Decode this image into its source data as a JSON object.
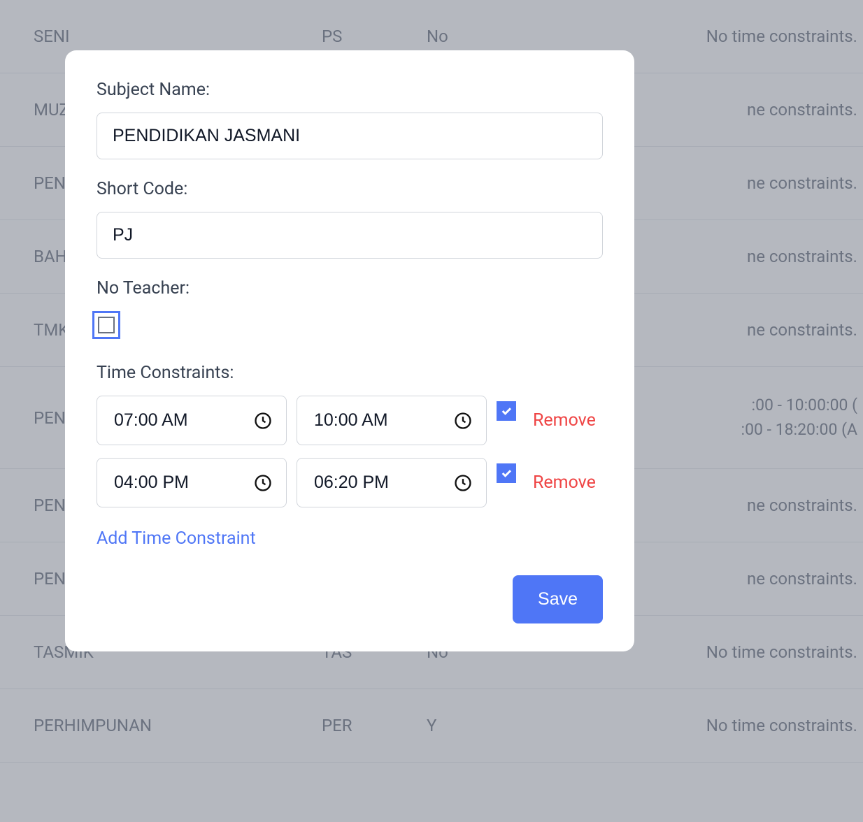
{
  "background": {
    "rows": [
      {
        "name": "SENI",
        "code": "PS",
        "teacher": "No",
        "constraints": "No time constraints."
      },
      {
        "name": "MUZIK",
        "code": "",
        "teacher": "",
        "constraints": "ne constraints."
      },
      {
        "name": "PENDIDIKAN ISLAM",
        "code": "",
        "teacher": "",
        "constraints": "ne constraints."
      },
      {
        "name": "BAHASA ARAB",
        "code": "",
        "teacher": "",
        "constraints": "ne constraints."
      },
      {
        "name": "TMK",
        "code": "",
        "teacher": "",
        "constraints": "ne constraints."
      },
      {
        "name": "PENDIDIKAN JASMANI",
        "code": "",
        "teacher": "",
        "constraints_line1": ":00 - 10:00:00 (",
        "constraints_line2": ":00 - 18:20:00 (A"
      },
      {
        "name": "PENDIDIKAN MORAL",
        "code": "",
        "teacher": "",
        "constraints": "ne constraints."
      },
      {
        "name": "PENDIDIKAN KESIHATAN",
        "code": "",
        "teacher": "",
        "constraints": "ne constraints."
      },
      {
        "name": "TASMIK",
        "code": "TAS",
        "teacher": "No",
        "constraints": "No time constraints."
      },
      {
        "name": "PERHIMPUNAN",
        "code": "PER",
        "teacher": "Y",
        "constraints": "No time constraints."
      }
    ]
  },
  "modal": {
    "subject_name_label": "Subject Name:",
    "subject_name_value": "PENDIDIKAN JASMANI",
    "short_code_label": "Short Code:",
    "short_code_value": "PJ",
    "no_teacher_label": "No Teacher:",
    "no_teacher_checked": false,
    "time_constraints_label": "Time Constraints:",
    "constraints": [
      {
        "start": "07:00 AM",
        "end": "10:00 AM",
        "checked": true,
        "remove_label": "Remove"
      },
      {
        "start": "04:00 PM",
        "end": "06:20 PM",
        "checked": true,
        "remove_label": "Remove"
      }
    ],
    "add_constraint_label": "Add Time Constraint",
    "save_label": "Save"
  }
}
